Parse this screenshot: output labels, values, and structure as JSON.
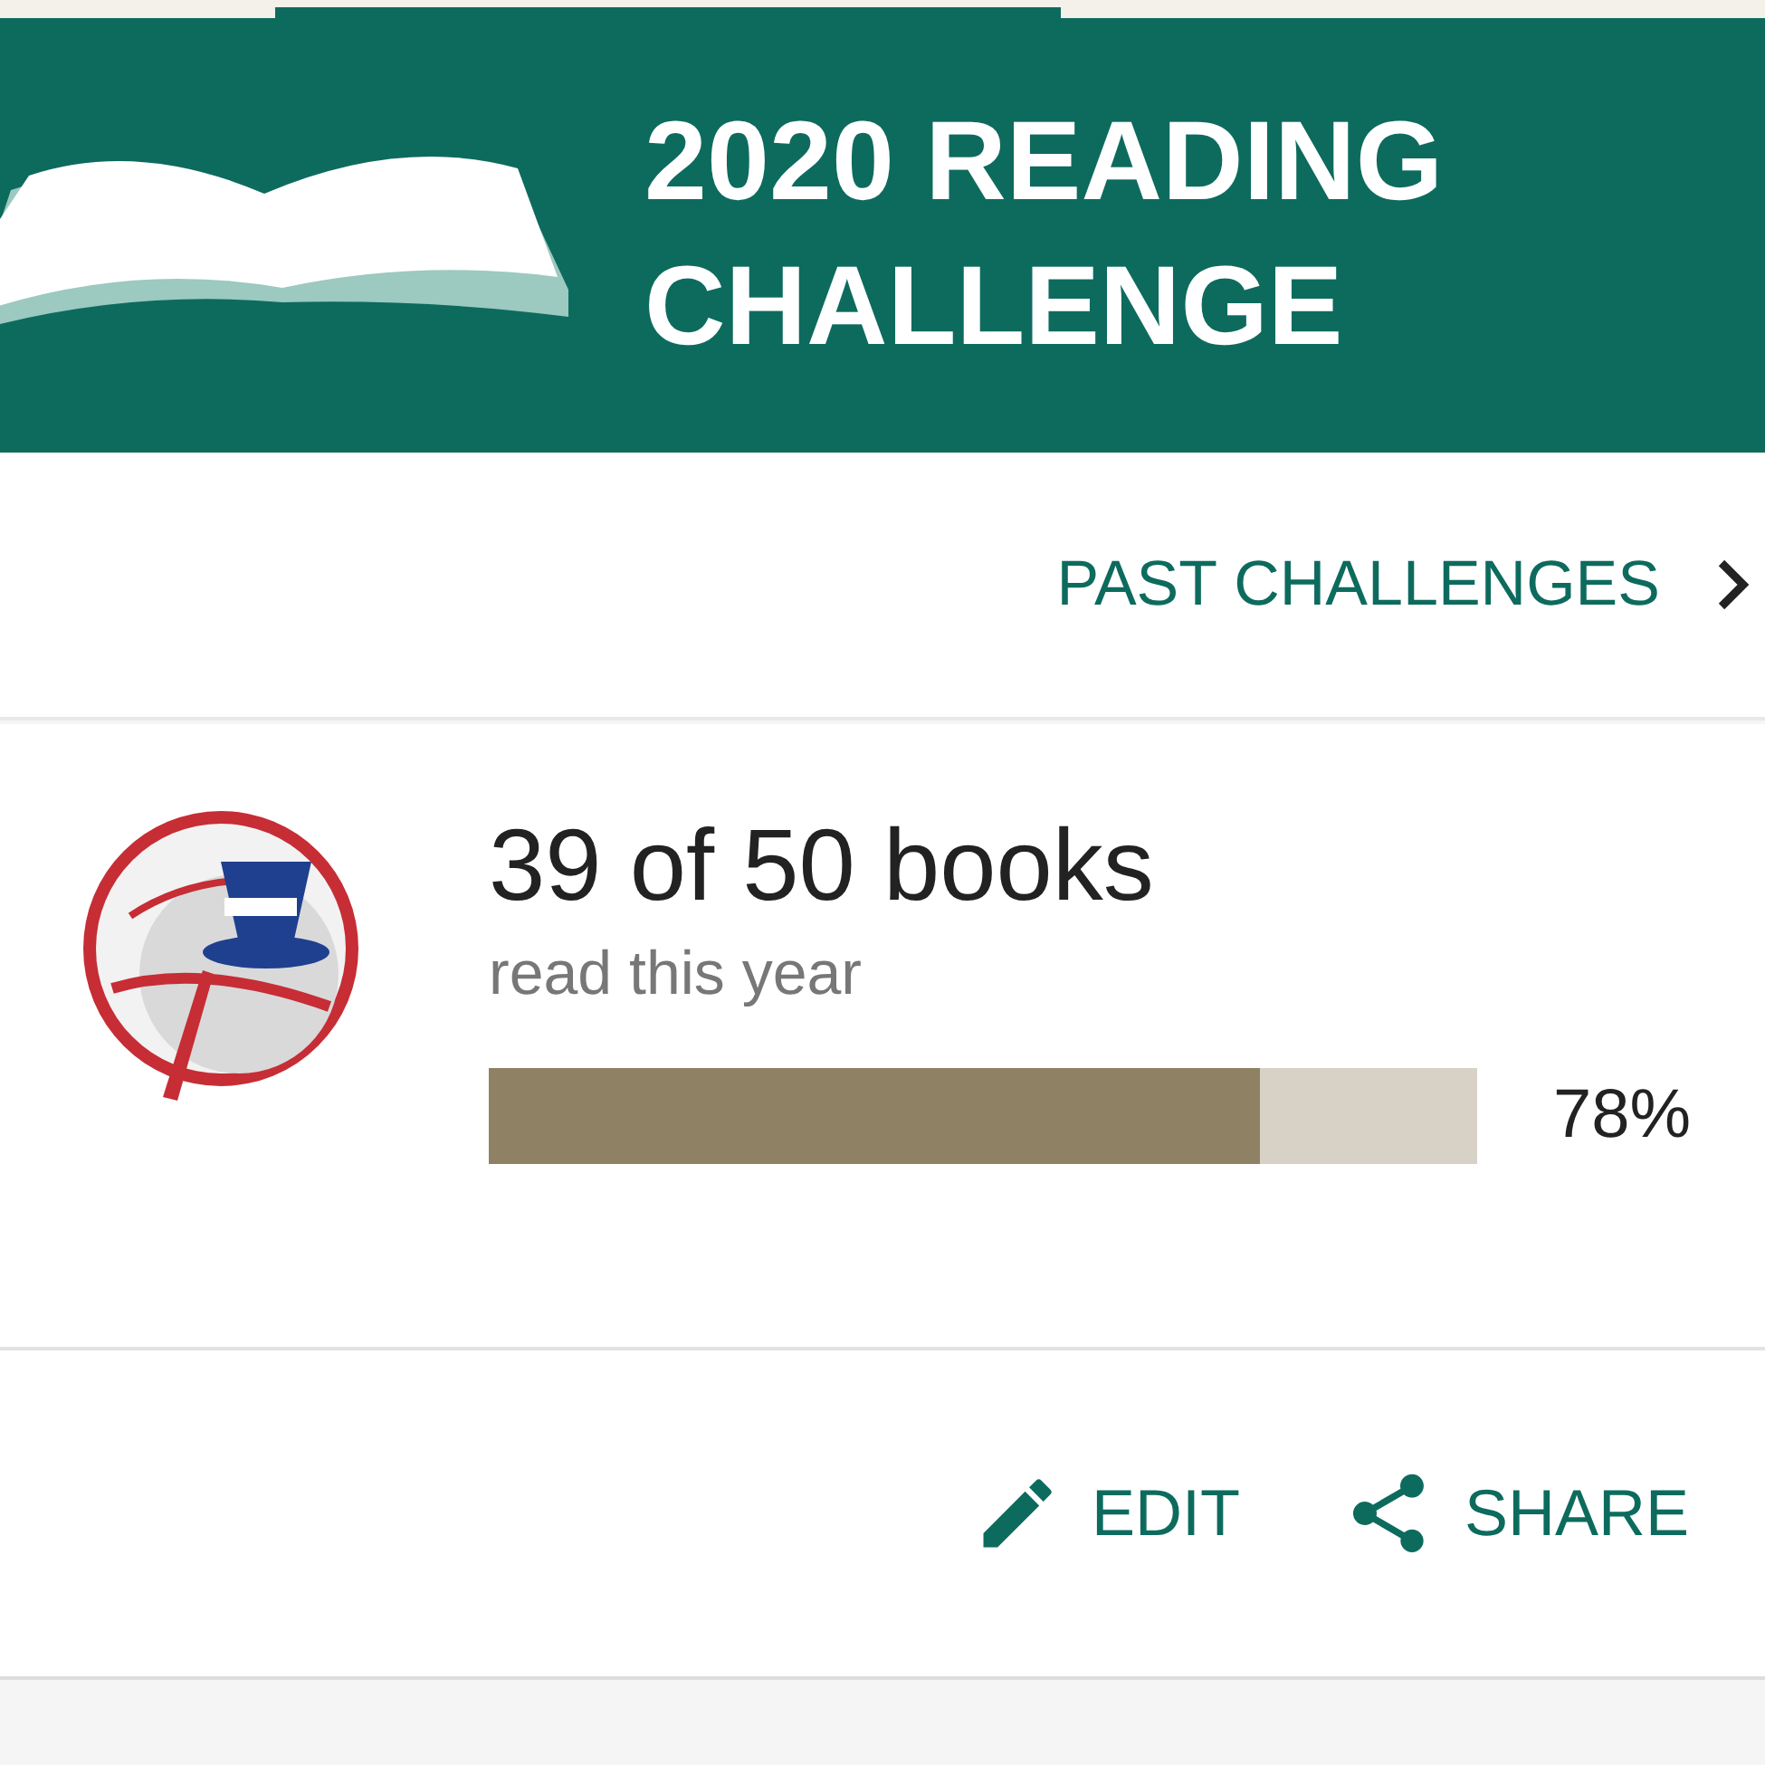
{
  "header": {
    "title_lines": [
      "2020 READING",
      "CHALLENGE"
    ]
  },
  "past_challenges_link": {
    "label": "PAST CHALLENGES"
  },
  "progress_card": {
    "count": "39 of 50 books",
    "caption": "read this year",
    "level": 0.78,
    "percent": "78%"
  },
  "actions": [
    {
      "kind": "edit",
      "label": "EDIT"
    },
    {
      "kind": "share",
      "label": "SHARE"
    }
  ]
}
